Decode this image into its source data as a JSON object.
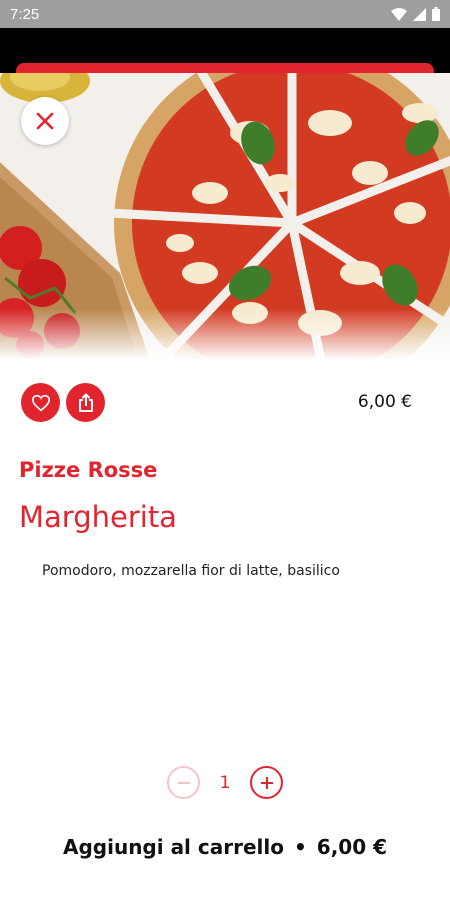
{
  "status_bar": {
    "time": "7:25"
  },
  "product": {
    "category": "Pizze Rosse",
    "name": "Margherita",
    "description": "Pomodoro, mozzarella fior di latte, basilico",
    "price": "6,00 €"
  },
  "quantity": {
    "value": "1"
  },
  "cart_button": {
    "label": "Aggiungi al carrello",
    "separator": "•",
    "total": "6,00 €"
  },
  "colors": {
    "accent": "#e2242e",
    "accent_light": "#f3c6c8",
    "status_bar": "#9e9e9e"
  },
  "icons": {
    "close": "close-icon",
    "favorite": "heart-icon",
    "share": "share-icon",
    "minus": "minus-icon",
    "plus": "plus-icon"
  }
}
